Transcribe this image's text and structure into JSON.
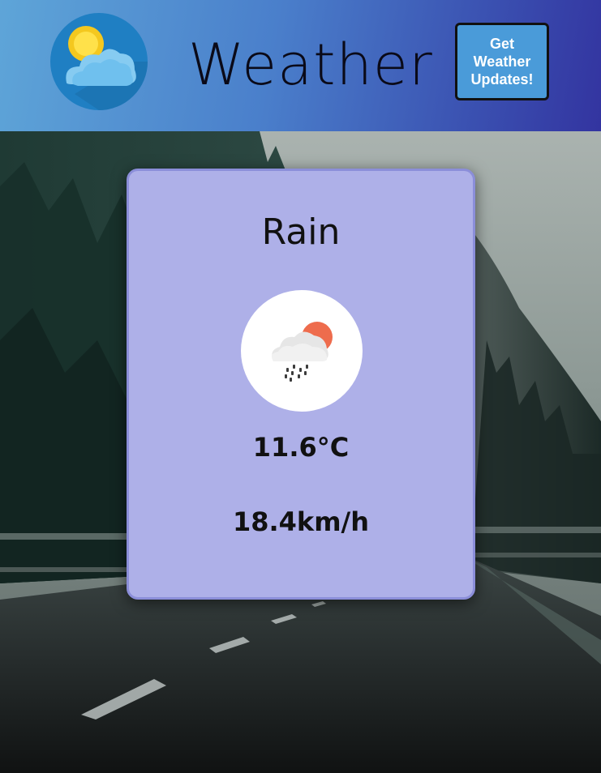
{
  "header": {
    "title": "Weather",
    "updates_button_label": "Get Weather Updates!"
  },
  "icons": {
    "logo": "sun-cloud-logo-icon",
    "condition": "rain-sun-icon"
  },
  "weather": {
    "condition": "Rain",
    "temperature": "11.6°C",
    "wind_speed": "18.4km/h"
  },
  "colors": {
    "header_gradient_start": "#5ea5d8",
    "header_gradient_end": "#3334a0",
    "button_background": "#4a9bd9",
    "card_background": "#aeb0e8",
    "card_border": "#8b8ed9",
    "sun_accent": "#ee6c4d"
  }
}
